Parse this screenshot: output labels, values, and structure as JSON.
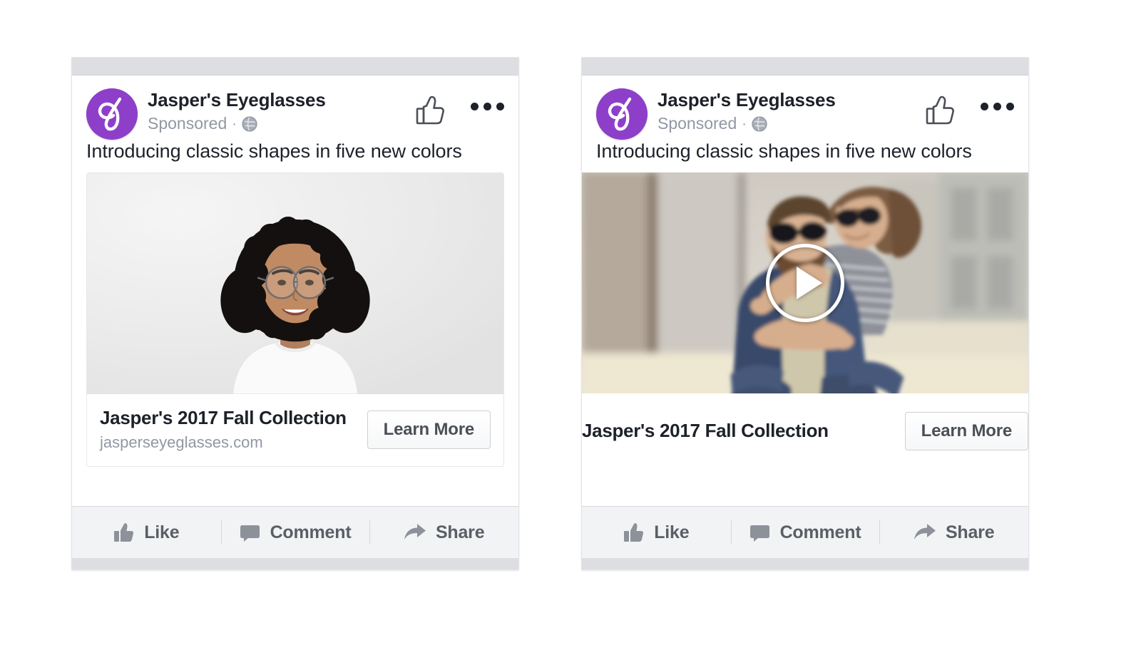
{
  "colors": {
    "brand_purple": "#8e3fc9",
    "text_primary": "#1d2129",
    "text_muted": "#9197a3",
    "action_text": "#5a5f66",
    "card_chrome_gray": "#dcdee1",
    "action_bar_bg": "#f2f3f5"
  },
  "cards": [
    {
      "id": "image-ad-card",
      "variant": "image",
      "header": {
        "avatar_icon": "jaspers-script-j-logo",
        "page_name": "Jasper's Eyeglasses",
        "sponsored_label": "Sponsored",
        "separator": "·",
        "audience_icon": "globe-icon",
        "like_icon": "thumbs-up-icon",
        "menu_icon": "ellipsis-icon"
      },
      "message": "Introducing classic shapes in five new colors",
      "media": {
        "type": "photo",
        "alt": "Smiling woman with curly hair wearing round eyeglasses on a light gray background"
      },
      "caption": {
        "title": "Jasper's 2017 Fall Collection",
        "url": "jasperseyeglasses.com",
        "cta_label": "Learn More"
      },
      "actions": [
        {
          "icon": "thumbs-up-icon",
          "label": "Like"
        },
        {
          "icon": "comment-bubble-icon",
          "label": "Comment"
        },
        {
          "icon": "share-arrow-icon",
          "label": "Share"
        }
      ]
    },
    {
      "id": "video-ad-card",
      "variant": "video",
      "header": {
        "avatar_icon": "jaspers-script-j-logo",
        "page_name": "Jasper's Eyeglasses",
        "sponsored_label": "Sponsored",
        "separator": "·",
        "audience_icon": "globe-icon",
        "like_icon": "thumbs-up-icon",
        "menu_icon": "ellipsis-icon"
      },
      "message": "Introducing classic shapes in five new colors",
      "media": {
        "type": "video",
        "play_icon": "play-button-icon",
        "alt": "Bearded man in sunglasses giving a smiling woman a piggyback ride outdoors"
      },
      "caption": {
        "title": "Jasper's 2017 Fall Collection",
        "url": "",
        "cta_label": "Learn More"
      },
      "actions": [
        {
          "icon": "thumbs-up-icon",
          "label": "Like"
        },
        {
          "icon": "comment-bubble-icon",
          "label": "Comment"
        },
        {
          "icon": "share-arrow-icon",
          "label": "Share"
        }
      ]
    }
  ]
}
